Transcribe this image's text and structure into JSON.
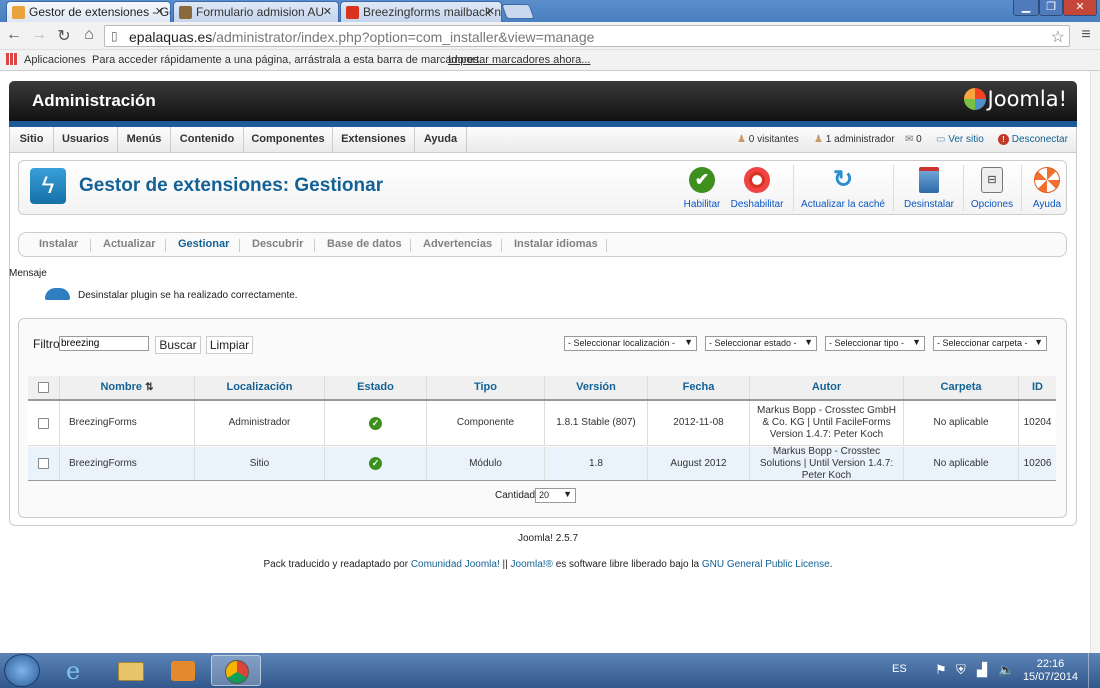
{
  "browser": {
    "tabs": [
      {
        "title": "Gestor de extensiones - Ge",
        "active": true,
        "favicon": "joomla-favicon"
      },
      {
        "title": "Formulario admision AU",
        "active": false,
        "favicon": "form-favicon"
      },
      {
        "title": "Breezingforms mailback n",
        "active": false,
        "favicon": "breezing-favicon"
      }
    ],
    "url_host": "epalaquas.es",
    "url_path": "/administrator/index.php?option=com_installer&view=manage",
    "bookmarks": {
      "apps_label": "Aplicaciones",
      "hint": "Para acceder rápidamente a una página, arrástrala a esta barra de marcadores.",
      "import_link": "Importar marcadores ahora..."
    }
  },
  "header": {
    "title": "Administración",
    "logo_text": "Joomla!"
  },
  "menu": {
    "items": [
      "Sitio",
      "Usuarios",
      "Menús",
      "Contenido",
      "Componentes",
      "Extensiones",
      "Ayuda"
    ],
    "status": {
      "visitors": "0 visitantes",
      "admins": "1 administrador",
      "messages": "0",
      "view_site": "Ver sitio",
      "logout": "Desconectar"
    }
  },
  "toolbar": {
    "page_title": "Gestor de extensiones: Gestionar",
    "buttons": [
      "Habilitar",
      "Deshabilitar",
      "Actualizar la caché",
      "Desinstalar",
      "Opciones",
      "Ayuda"
    ]
  },
  "subnav": {
    "items": [
      "Instalar",
      "Actualizar",
      "Gestionar",
      "Descubrir",
      "Base de datos",
      "Advertencias",
      "Instalar idiomas"
    ],
    "active": "Gestionar"
  },
  "message": {
    "title": "Mensaje",
    "text": "Desinstalar plugin se ha realizado correctamente."
  },
  "filter": {
    "label": "Filtro:",
    "value": "breezing",
    "search_button": "Buscar",
    "clear_button": "Limpiar",
    "selects": [
      "- Seleccionar localización -",
      "- Seleccionar estado -",
      "- Seleccionar tipo -",
      "- Seleccionar carpeta -"
    ]
  },
  "table": {
    "columns": [
      "Nombre",
      "Localización",
      "Estado",
      "Tipo",
      "Versión",
      "Fecha",
      "Autor",
      "Carpeta",
      "ID"
    ],
    "rows": [
      {
        "name": "BreezingForms",
        "location": "Administrador",
        "status": "enabled",
        "type": "Componente",
        "version": "1.8.1 Stable (807)",
        "date": "2012-11-08",
        "author": "Markus Bopp - Crosstec GmbH & Co. KG | Until FacileForms Version 1.4.7: Peter Koch",
        "folder": "No aplicable",
        "id": "10204"
      },
      {
        "name": "BreezingForms",
        "location": "Sitio",
        "status": "enabled",
        "type": "Módulo",
        "version": "1.8",
        "date": "August 2012",
        "author": "Markus Bopp - Crosstec Solutions | Until Version 1.4.7: Peter Koch",
        "folder": "No aplicable",
        "id": "10206"
      }
    ],
    "limit_label": "Cantidad",
    "limit_value": "20"
  },
  "footer": {
    "version": "Joomla! 2.5.7",
    "pack_text_1": "Pack traducido y readaptado por",
    "community_link": "Comunidad Joomla!",
    "sep": "||",
    "joomla_link": "Joomla!®",
    "pack_text_2": "es software libre liberado bajo la",
    "license_link": "GNU General Public License",
    "period": "."
  },
  "taskbar": {
    "lang": "ES",
    "time": "22:16",
    "date": "15/07/2014"
  },
  "colors": {
    "joomla_blue": "#146295",
    "header_dark": "#1b1b1b",
    "ok_green": "#3d8f1e",
    "disable_red": "#d9331f"
  }
}
